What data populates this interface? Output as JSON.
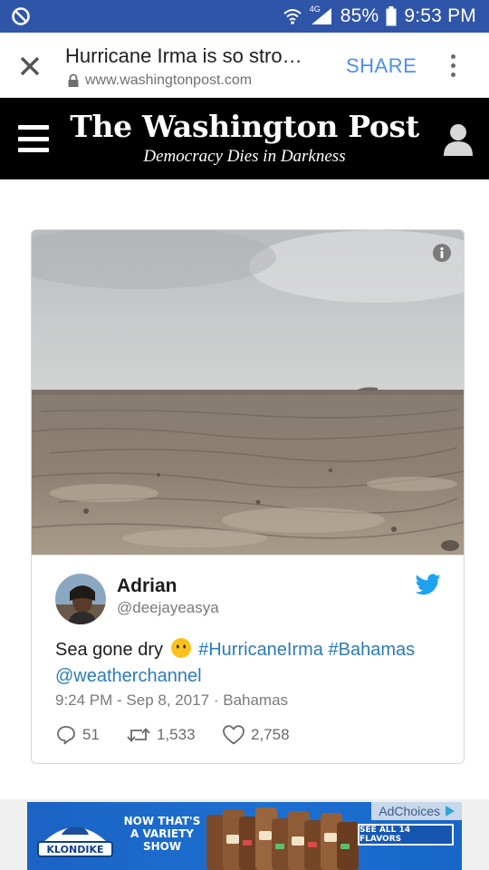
{
  "status_bar": {
    "network": "4G",
    "battery": "85%",
    "time": "9:53 PM",
    "icons": [
      "blocked-icon",
      "wifi-icon",
      "signal-icon",
      "battery-icon"
    ]
  },
  "browser": {
    "page_title": "Hurricane Irma is so stro…",
    "url": "www.washingtonpost.com",
    "share_label": "SHARE",
    "share_color": "#4b8ff0"
  },
  "site_header": {
    "masthead": "The Washington Post",
    "tagline": "Democracy Dies in Darkness"
  },
  "tweet": {
    "display_name": "Adrian",
    "handle": "@deejayeasya",
    "text_start": "Sea gone dry",
    "hashtag_1": "#HurricaneIrma",
    "hashtag_2": "#Bahamas",
    "mention": "@weatherchannel",
    "timestamp": "9:24 PM - Sep 8, 2017",
    "location": "Bahamas",
    "replies": "51",
    "retweets": "1,533",
    "likes": "2,758",
    "link_color": "#2b7bb9",
    "twitter_color": "#1da1f2"
  },
  "ad": {
    "adchoices_label": "AdChoices",
    "brand": "KLONDIKE",
    "headline_line1": "NOW THAT'S",
    "headline_line2": "A VARIETY",
    "headline_line3": "SHOW",
    "cta": "SEE ALL 14 FLAVORS"
  },
  "colors": {
    "status_bar": "#2f55a8",
    "header_bg": "#000000",
    "ad_bg": "#1c70d1"
  }
}
